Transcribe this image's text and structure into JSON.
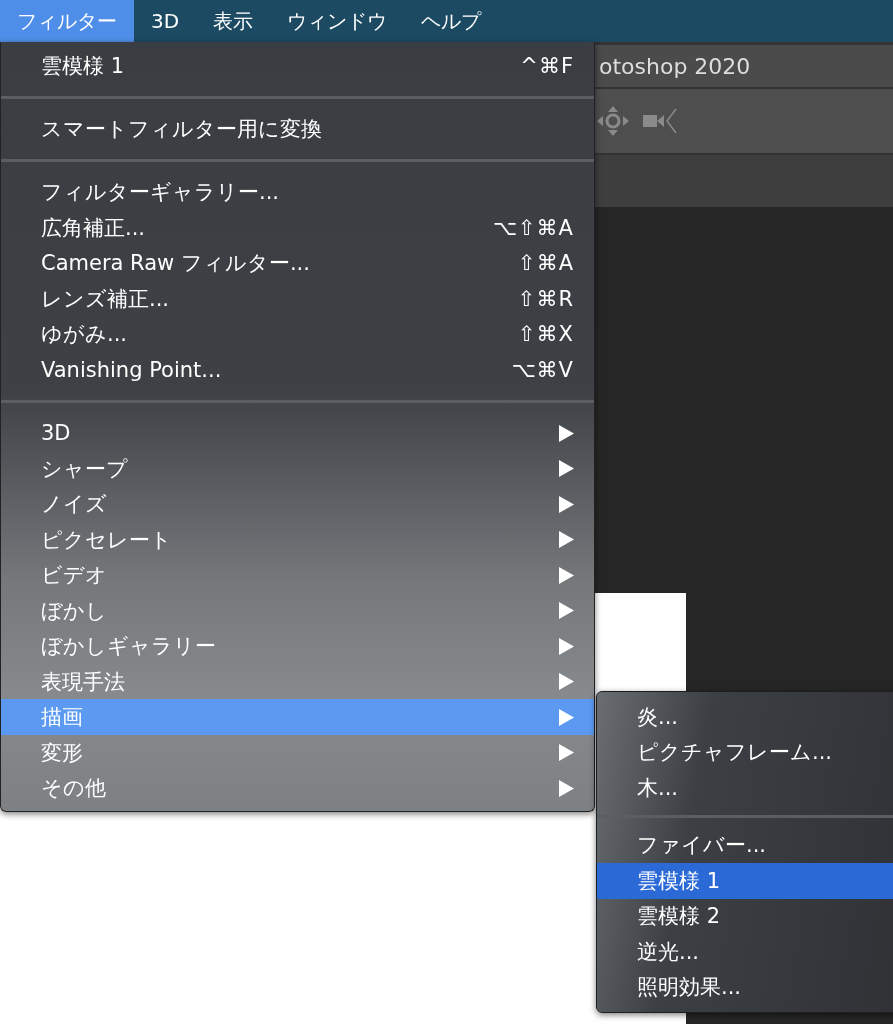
{
  "menubar": [
    {
      "label": "フィルター",
      "selected": true
    },
    {
      "label": "3D",
      "selected": false
    },
    {
      "label": "表示",
      "selected": false
    },
    {
      "label": "ウィンドウ",
      "selected": false
    },
    {
      "label": "ヘルプ",
      "selected": false
    }
  ],
  "window": {
    "title": "otoshop 2020"
  },
  "menu": [
    {
      "kind": "item",
      "label": "雲模様 1",
      "shortcut": "^⌘F",
      "selected": false
    },
    {
      "kind": "separator"
    },
    {
      "kind": "item",
      "label": "スマートフィルター用に変換",
      "selected": false
    },
    {
      "kind": "separator"
    },
    {
      "kind": "item",
      "label": "フィルターギャラリー...",
      "selected": false
    },
    {
      "kind": "item",
      "label": "広角補正...",
      "shortcut": "⌥⇧⌘A",
      "selected": false
    },
    {
      "kind": "item",
      "label": "Camera Raw フィルター...",
      "shortcut": "⇧⌘A",
      "selected": false
    },
    {
      "kind": "item",
      "label": "レンズ補正...",
      "shortcut": "⇧⌘R",
      "selected": false
    },
    {
      "kind": "item",
      "label": "ゆがみ...",
      "shortcut": "⇧⌘X",
      "selected": false
    },
    {
      "kind": "item",
      "label": "Vanishing Point...",
      "shortcut": "⌥⌘V",
      "selected": false
    },
    {
      "kind": "separator"
    },
    {
      "kind": "submenu",
      "label": "3D",
      "selected": false
    },
    {
      "kind": "submenu",
      "label": "シャープ",
      "selected": false
    },
    {
      "kind": "submenu",
      "label": "ノイズ",
      "selected": false
    },
    {
      "kind": "submenu",
      "label": "ピクセレート",
      "selected": false
    },
    {
      "kind": "submenu",
      "label": "ビデオ",
      "selected": false
    },
    {
      "kind": "submenu",
      "label": "ぼかし",
      "selected": false
    },
    {
      "kind": "submenu",
      "label": "ぼかしギャラリー",
      "selected": false
    },
    {
      "kind": "submenu",
      "label": "表現手法",
      "selected": false
    },
    {
      "kind": "submenu",
      "label": "描画",
      "selected": true
    },
    {
      "kind": "submenu",
      "label": "変形",
      "selected": false
    },
    {
      "kind": "submenu",
      "label": "その他",
      "selected": false
    }
  ],
  "submenu": [
    {
      "kind": "item",
      "label": "炎...",
      "selected": false
    },
    {
      "kind": "item",
      "label": "ピクチャフレーム...",
      "selected": false
    },
    {
      "kind": "item",
      "label": "木...",
      "selected": false
    },
    {
      "kind": "separator"
    },
    {
      "kind": "item",
      "label": "ファイバー...",
      "selected": false
    },
    {
      "kind": "item",
      "label": "雲模様 1",
      "selected": true
    },
    {
      "kind": "item",
      "label": "雲模様 2",
      "selected": false
    },
    {
      "kind": "item",
      "label": "逆光...",
      "selected": false
    },
    {
      "kind": "item",
      "label": "照明効果...",
      "selected": false
    }
  ]
}
